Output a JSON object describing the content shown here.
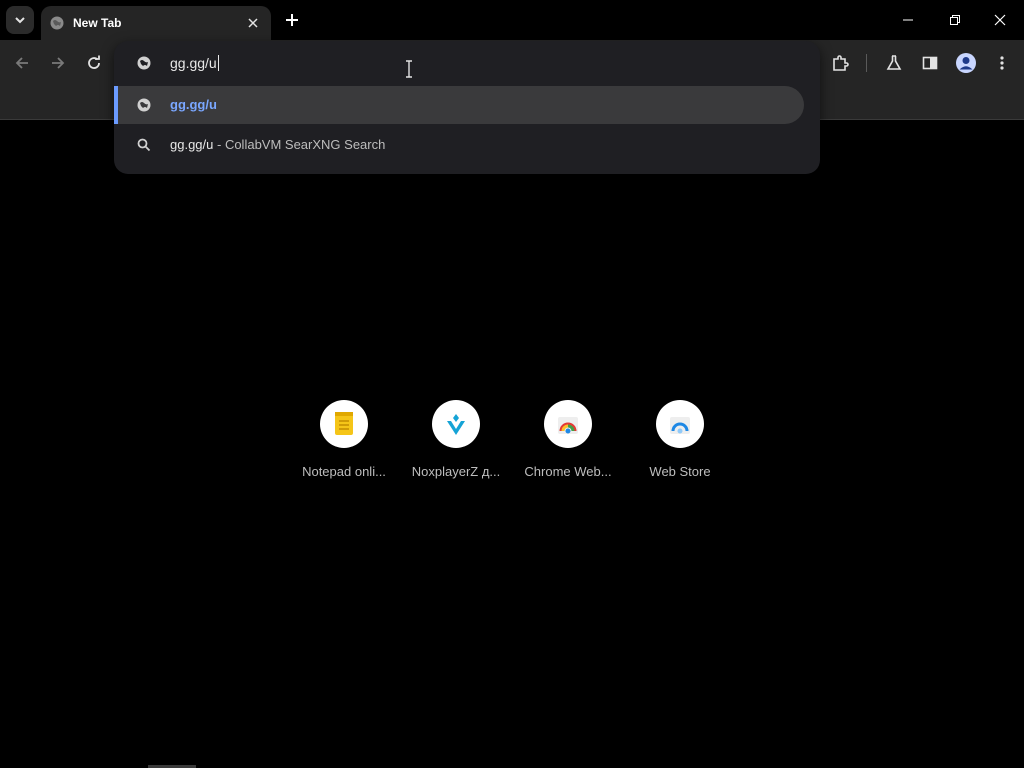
{
  "tab": {
    "title": "New Tab"
  },
  "omnibox": {
    "input_text": "gg.gg/u",
    "suggestions": [
      {
        "url": "gg.gg/u",
        "desc": ""
      },
      {
        "url": "gg.gg/u",
        "desc": "- CollabVM SearXNG Search"
      }
    ]
  },
  "shortcuts": [
    {
      "label": "Notepad onli..."
    },
    {
      "label": "NoxplayerZ д..."
    },
    {
      "label": "Chrome Web..."
    },
    {
      "label": "Web Store"
    }
  ],
  "colors": {
    "accent": "#6b9bff",
    "background": "#000000",
    "toolbar": "#252525"
  }
}
